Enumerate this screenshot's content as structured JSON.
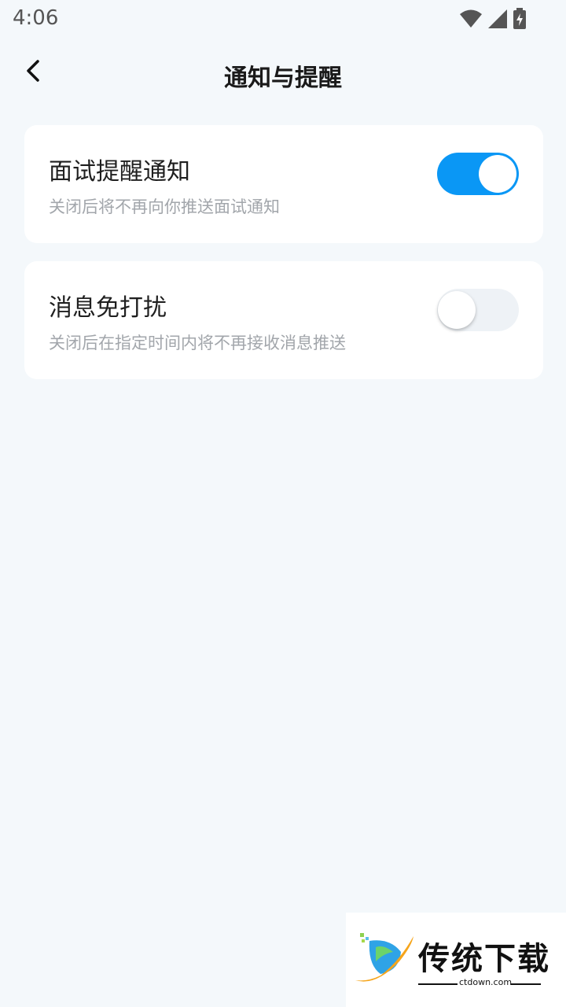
{
  "status_bar": {
    "time": "4:06",
    "icons": [
      "wifi-icon",
      "cellular-signal-icon",
      "battery-charging-icon"
    ]
  },
  "header": {
    "title": "通知与提醒",
    "back_icon": "chevron-left-icon"
  },
  "settings": [
    {
      "title": "面试提醒通知",
      "description": "关闭后将不再向你推送面试通知",
      "enabled": true
    },
    {
      "title": "消息免打扰",
      "description": "关闭后在指定时间内将不再接收消息推送",
      "enabled": false
    }
  ],
  "colors": {
    "background": "#f4f8fb",
    "card": "#ffffff",
    "toggle_on": "#0a97f5",
    "toggle_off": "#eef2f6",
    "desc_text": "#a2a6ab"
  },
  "watermark": {
    "brand": "传统下载",
    "domain": "ctdown.com"
  }
}
